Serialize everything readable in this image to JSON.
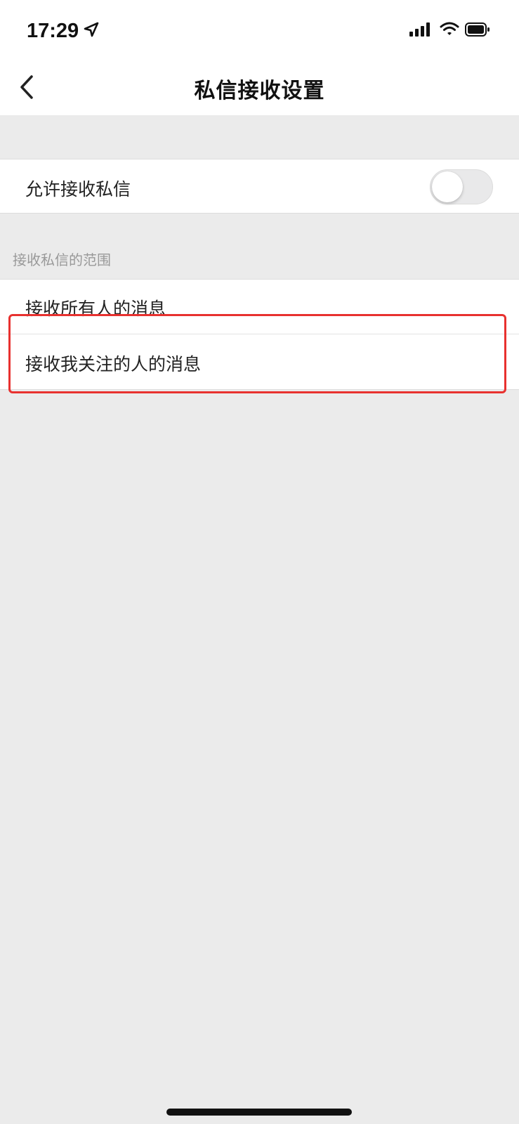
{
  "status_bar": {
    "time": "17:29",
    "icons": [
      "location-arrow-icon",
      "signal-icon",
      "wifi-icon",
      "battery-icon"
    ]
  },
  "nav": {
    "title": "私信接收设置",
    "back_icon": "chevron-left-icon"
  },
  "settings": {
    "allow_label": "允许接收私信",
    "allow_enabled": false
  },
  "scope": {
    "header": "接收私信的范围",
    "options": [
      {
        "label": "接收所有人的消息"
      },
      {
        "label": "接收我关注的人的消息",
        "highlighted": true
      }
    ]
  },
  "colors": {
    "highlight": "#e8312f",
    "background": "#ebebeb",
    "toggle_off": "#e9e9ea"
  }
}
